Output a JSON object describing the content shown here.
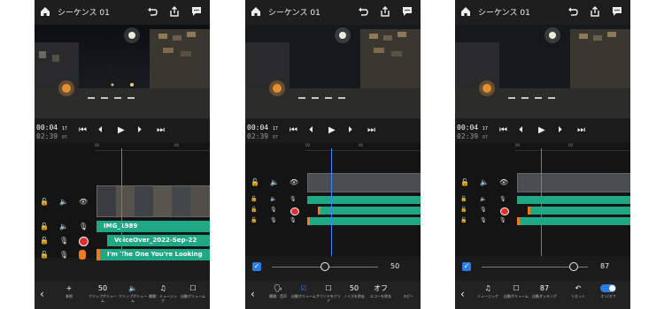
{
  "colors": {
    "accent": "#3a82ff",
    "audio_clip": "#20a884",
    "record": "#e02c2c",
    "clip_start": "#f07a1f"
  },
  "header": {
    "title": "シーケンス 01"
  },
  "timecode": {
    "current": "00:04",
    "current_frames": "17",
    "duration": "02:39",
    "duration_frames": "07"
  },
  "ruler_ticks": [
    "00",
    "00"
  ],
  "panel1": {
    "clips": {
      "video": "IMG_1989",
      "voiceover": "VoiceOver_2022-Sep-22",
      "music": "I'm The One You're Looking"
    },
    "toolbar": [
      {
        "value": "+",
        "label": "参照"
      },
      {
        "value": "50",
        "label": "クリップボリューム"
      },
      {
        "value": "",
        "label": "クリップボリューム"
      },
      {
        "value": "♫",
        "label": "種類：ミュージック"
      },
      {
        "value": "",
        "label": "自動ボリューム"
      }
    ]
  },
  "panel2": {
    "slider_value": "50",
    "slider_level_percent": 50,
    "toolbar": [
      {
        "value": "",
        "label": "種類：音声"
      },
      {
        "value": "",
        "label": "自動ボリューム"
      },
      {
        "value": "",
        "label": "サウンドをクリア"
      },
      {
        "value": "50",
        "label": "ノイズを除去"
      },
      {
        "value": "オフ",
        "label": "エコーを除去"
      },
      {
        "value": "",
        "label": "スピー"
      }
    ]
  },
  "panel3": {
    "slider_value": "87",
    "slider_level_percent": 87,
    "toolbar": [
      {
        "value": "♫",
        "label": "ミュージック"
      },
      {
        "value": "",
        "label": "自動ボリューム"
      },
      {
        "value": "87",
        "label": "自動ダッキング"
      },
      {
        "value": "",
        "label": "リセット"
      },
      {
        "value": "",
        "label": "オン/オフ"
      }
    ]
  }
}
